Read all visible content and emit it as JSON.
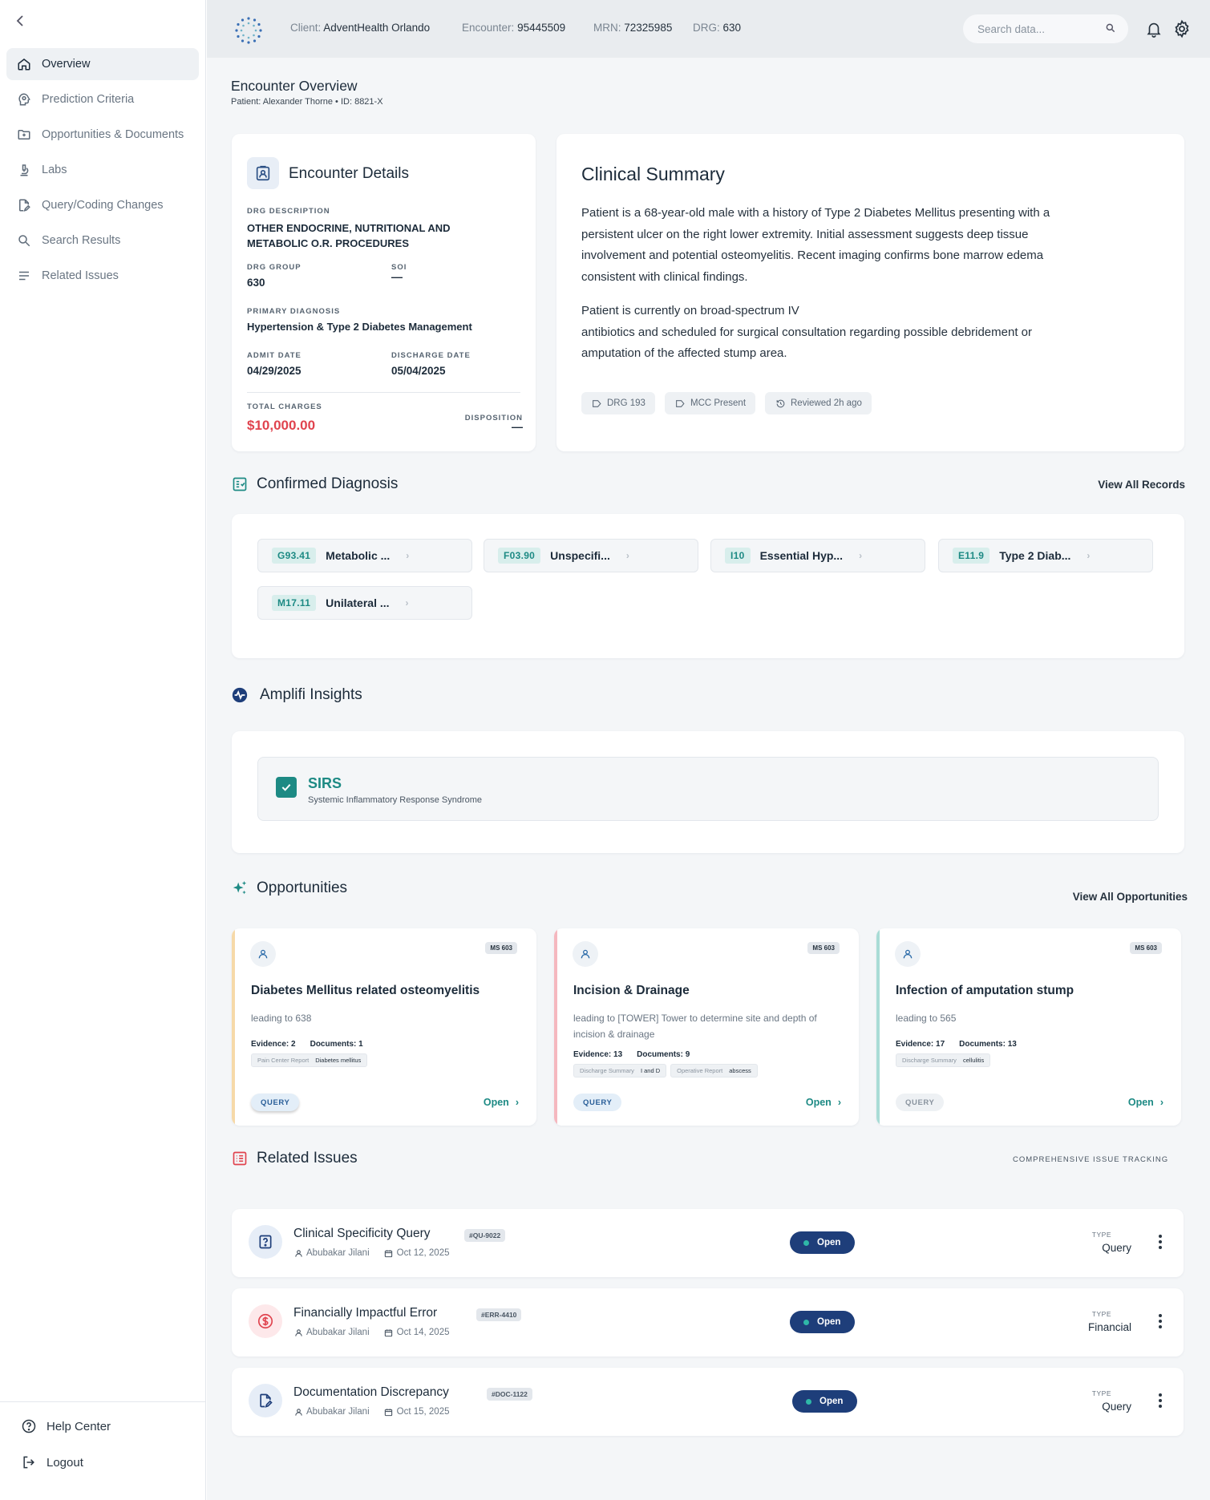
{
  "sidebar": {
    "items": [
      {
        "label": "Overview",
        "icon": "home-icon"
      },
      {
        "label": "Prediction Criteria",
        "icon": "head-brain-icon"
      },
      {
        "label": "Opportunities & Documents",
        "icon": "folder-icon"
      },
      {
        "label": "Labs",
        "icon": "microscope-icon"
      },
      {
        "label": "Query/Coding Changes",
        "icon": "file-edit-icon"
      },
      {
        "label": "Search Results",
        "icon": "search-icon"
      },
      {
        "label": "Related Issues",
        "icon": "list-icon"
      }
    ],
    "footer": {
      "help": "Help Center",
      "logout": "Logout"
    }
  },
  "topbar": {
    "client_label": "Client:",
    "client": "AdventHealth Orlando",
    "encounter_label": "Encounter:",
    "encounter": "95445509",
    "mrn_label": "MRN:",
    "mrn": "72325985",
    "drg_label": "DRG:",
    "drg": "630",
    "search_placeholder": "Search data..."
  },
  "page": {
    "title": "Encounter Overview",
    "subtitle": "Patient: Alexander Thorne • ID: 8821-X"
  },
  "encounter_details": {
    "title": "Encounter Details",
    "drg_description_label": "DRG DESCRIPTION",
    "drg_description": "OTHER ENDOCRINE, NUTRITIONAL AND METABOLIC O.R. PROCEDURES",
    "drg_group_label": "DRG GROUP",
    "drg_group": "630",
    "soi_label": "SOI",
    "soi": "—",
    "primary_dx_label": "PRIMARY DIAGNOSIS",
    "primary_dx": "Hypertension & Type 2 Diabetes Management",
    "admit_label": "ADMIT DATE",
    "admit": "04/29/2025",
    "discharge_label": "DISCHARGE DATE",
    "discharge": "05/04/2025",
    "charges_label": "TOTAL CHARGES",
    "charges": "$10,000.00",
    "disposition_label": "DISPOSITION",
    "disposition": "—"
  },
  "clinical_summary": {
    "title": "Clinical Summary",
    "para1": "Patient is a 68-year-old male with a history of Type 2 Diabetes Mellitus presenting with a persistent ulcer on the right lower extremity. Initial assessment suggests deep tissue involvement and potential osteomyelitis. Recent imaging confirms bone marrow edema consistent with clinical findings.",
    "para2_line1": "Patient is currently on broad-spectrum IV",
    "para2_line2": "antibiotics and scheduled for surgical consultation regarding possible debridement or amputation of the affected stump area.",
    "chips": [
      "DRG 193",
      "MCC Present",
      "Reviewed 2h ago"
    ]
  },
  "confirmed_diagnosis": {
    "title": "Confirmed Diagnosis",
    "link": "View All Records",
    "items": [
      {
        "code": "G93.41",
        "label": "Metabolic ..."
      },
      {
        "code": "F03.90",
        "label": "Unspecifi..."
      },
      {
        "code": "I10",
        "label": "Essential Hyp..."
      },
      {
        "code": "E11.9",
        "label": "Type 2 Diab..."
      },
      {
        "code": "M17.11",
        "label": "Unilateral ..."
      }
    ]
  },
  "insights": {
    "title": "Amplifi Insights",
    "item_title": "SIRS",
    "item_sub": "Systemic Inflammatory Response Syndrome"
  },
  "opportunities": {
    "title": "Opportunities",
    "link": "View All Opportunities",
    "cards": [
      {
        "badge": "MS 603",
        "title": "Diabetes Mellitus related osteomyelitis",
        "desc": "leading to 638",
        "evidence": "Evidence: 2",
        "documents": "Documents: 1",
        "tags": [
          {
            "k": "Pain Center Report",
            "v": "Diabetes mellitus"
          }
        ],
        "query": "QUERY",
        "open": "Open",
        "accent": "#f6d9a8"
      },
      {
        "badge": "MS 603",
        "title": "Incision & Drainage",
        "desc": "leading to [TOWER] Tower to determine site and depth of incision & drainage",
        "evidence": "Evidence: 13",
        "documents": "Documents: 9",
        "tags": [
          {
            "k": "Discharge Summary",
            "v": "I and D"
          },
          {
            "k": "Operative Report",
            "v": "abscess"
          }
        ],
        "query": "QUERY",
        "open": "Open",
        "accent": "#f5b8bf"
      },
      {
        "badge": "MS 603",
        "title": "Infection of amputation stump",
        "desc": "leading to 565",
        "evidence": "Evidence: 17",
        "documents": "Documents: 13",
        "tags": [
          {
            "k": "Discharge Summary",
            "v": "cellulitis"
          }
        ],
        "query": "QUERY",
        "open": "Open",
        "accent": "#a9dcd6"
      }
    ]
  },
  "related_issues": {
    "title": "Related Issues",
    "caption": "COMPREHENSIVE ISSUE TRACKING",
    "items": [
      {
        "title": "Clinical Specificity Query",
        "id": "#QU-9022",
        "user": "Abubakar Jilani",
        "date": "Oct 12, 2025",
        "status": "Open",
        "type_label": "TYPE",
        "type": "Query",
        "icon": "question-doc-icon"
      },
      {
        "title": "Financially Impactful Error",
        "id": "#ERR-4410",
        "user": "Abubakar Jilani",
        "date": "Oct 14, 2025",
        "status": "Open",
        "type_label": "TYPE",
        "type": "Financial",
        "icon": "dollar-icon"
      },
      {
        "title": "Documentation Discrepancy",
        "id": "#DOC-1122",
        "user": "Abubakar Jilani",
        "date": "Oct 15, 2025",
        "status": "Open",
        "type_label": "TYPE",
        "type": "Query",
        "icon": "file-edit-icon"
      }
    ]
  },
  "colors": {
    "accent_teal": "#1d8a84",
    "danger": "#e0434e",
    "status_blue": "#1e3e7a"
  }
}
